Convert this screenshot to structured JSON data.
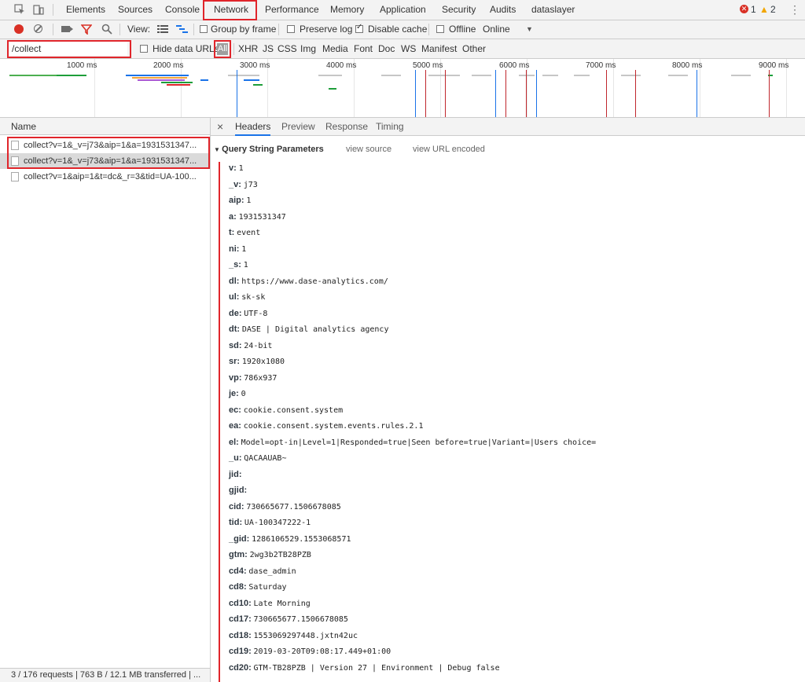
{
  "top_tabs": [
    "Elements",
    "Sources",
    "Console",
    "Network",
    "Performance",
    "Memory",
    "Application",
    "Security",
    "Audits",
    "dataslayer"
  ],
  "error_count": "1",
  "warning_count": "2",
  "toolbar": {
    "view_label": "View:",
    "group_by_frame": "Group by frame",
    "preserve_log": "Preserve log",
    "disable_cache": "Disable cache",
    "offline": "Offline",
    "throttle": "Online"
  },
  "filter": {
    "value": "/collect",
    "hide_data_urls": "Hide data URLs",
    "types": [
      "All",
      "XHR",
      "JS",
      "CSS",
      "Img",
      "Media",
      "Font",
      "Doc",
      "WS",
      "Manifest",
      "Other"
    ]
  },
  "timeline_ticks": [
    "1000 ms",
    "2000 ms",
    "3000 ms",
    "4000 ms",
    "5000 ms",
    "6000 ms",
    "7000 ms",
    "8000 ms",
    "9000 ms"
  ],
  "requests": {
    "header": "Name",
    "rows": [
      "collect?v=1&_v=j73&aip=1&a=1931531347...",
      "collect?v=1&_v=j73&aip=1&a=1931531347...",
      "collect?v=1&aip=1&t=dc&_r=3&tid=UA-100..."
    ],
    "status": "3 / 176 requests  |  763 B / 12.1 MB transferred  |  ..."
  },
  "detail_tabs": [
    "Headers",
    "Preview",
    "Response",
    "Timing"
  ],
  "query": {
    "title": "Query String Parameters",
    "view_source": "view source",
    "view_url_encoded": "view URL encoded",
    "params": [
      {
        "k": "v:",
        "v": "1"
      },
      {
        "k": "_v:",
        "v": "j73"
      },
      {
        "k": "aip:",
        "v": "1"
      },
      {
        "k": "a:",
        "v": "1931531347"
      },
      {
        "k": "t:",
        "v": "event"
      },
      {
        "k": "ni:",
        "v": "1"
      },
      {
        "k": "_s:",
        "v": "1"
      },
      {
        "k": "dl:",
        "v": "https://www.dase-analytics.com/"
      },
      {
        "k": "ul:",
        "v": "sk-sk"
      },
      {
        "k": "de:",
        "v": "UTF-8"
      },
      {
        "k": "dt:",
        "v": "DASE | Digital analytics agency"
      },
      {
        "k": "sd:",
        "v": "24-bit"
      },
      {
        "k": "sr:",
        "v": "1920x1080"
      },
      {
        "k": "vp:",
        "v": "786x937"
      },
      {
        "k": "je:",
        "v": "0"
      },
      {
        "k": "ec:",
        "v": "cookie.consent.system"
      },
      {
        "k": "ea:",
        "v": "cookie.consent.system.events.rules.2.1"
      },
      {
        "k": "el:",
        "v": "Model=opt-in|Level=1|Responded=true|Seen before=true|Variant=|Users choice="
      },
      {
        "k": "_u:",
        "v": "QACAAUAB~"
      },
      {
        "k": "jid:",
        "v": ""
      },
      {
        "k": "gjid:",
        "v": ""
      },
      {
        "k": "cid:",
        "v": "730665677.1506678085"
      },
      {
        "k": "tid:",
        "v": "UA-100347222-1"
      },
      {
        "k": "_gid:",
        "v": "1286106529.1553068571"
      },
      {
        "k": "gtm:",
        "v": "2wg3b2TB28PZB"
      },
      {
        "k": "cd4:",
        "v": "dase_admin"
      },
      {
        "k": "cd8:",
        "v": "Saturday"
      },
      {
        "k": "cd10:",
        "v": "Late Morning"
      },
      {
        "k": "cd17:",
        "v": "730665677.1506678085"
      },
      {
        "k": "cd18:",
        "v": "1553069297448.jxtn42uc"
      },
      {
        "k": "cd19:",
        "v": "2019-03-20T09:08:17.449+01:00"
      },
      {
        "k": "cd20:",
        "v": "GTM-TB28PZB | Version 27 |  Environment  | Debug false"
      }
    ]
  },
  "colors": {
    "accent_red": "#e0252b",
    "record_red": "#d93025",
    "filter_red": "#e0252b"
  }
}
